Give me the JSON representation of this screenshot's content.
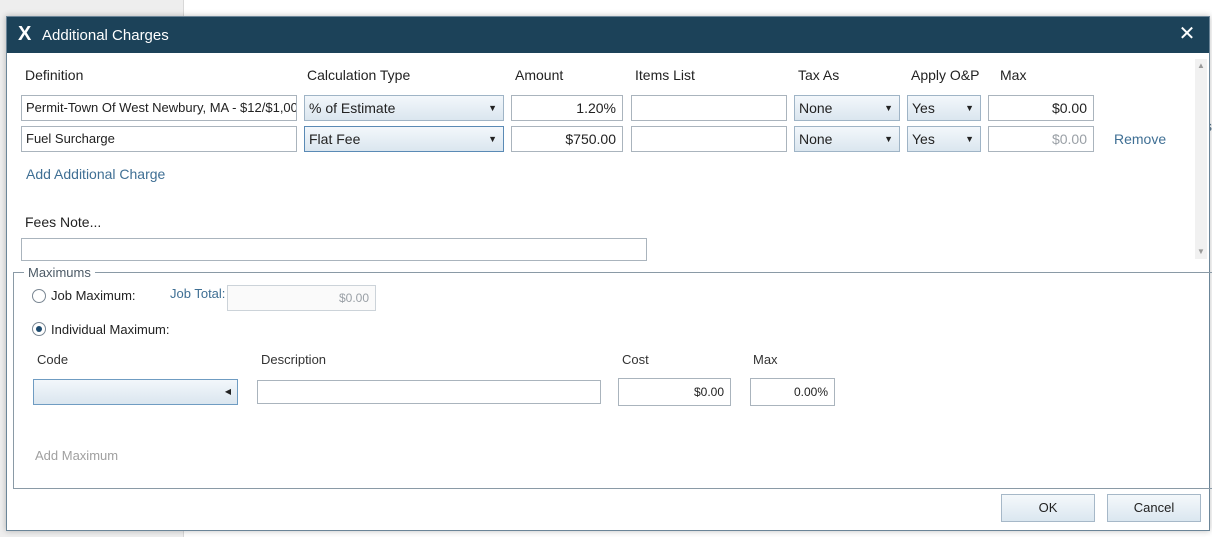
{
  "background": {
    "edge_glyph_1": "s",
    "edge_glyph_2": "r"
  },
  "dialog": {
    "title": "Additional Charges",
    "icons": {
      "app": "app-x-logo-icon",
      "close": "close-icon"
    }
  },
  "charges": {
    "headers": {
      "definition": "Definition",
      "calculation_type": "Calculation Type",
      "amount": "Amount",
      "items_list": "Items List",
      "tax_as": "Tax As",
      "apply_op": "Apply O&P",
      "max": "Max"
    },
    "rows": [
      {
        "definition": "Permit-Town Of West Newbury, MA - $12/$1,00",
        "calculation_type": "% of Estimate",
        "amount": "1.20%",
        "items_list": "",
        "tax_as": "None",
        "apply_op": "Yes",
        "max": "$0.00",
        "remove_label": ""
      },
      {
        "definition": "Fuel Surcharge",
        "calculation_type": "Flat Fee",
        "amount": "$750.00",
        "items_list": "",
        "tax_as": "None",
        "apply_op": "Yes",
        "max": "$0.00",
        "remove_label": "Remove"
      }
    ],
    "add_label": "Add Additional Charge",
    "fees_note_label": "Fees Note...",
    "fees_note_value": ""
  },
  "maximums": {
    "legend": "Maximums",
    "job_maximum_label": "Job Maximum:",
    "job_total_label": "Job Total:",
    "job_total_value": "$0.00",
    "individual_maximum_label": "Individual Maximum:",
    "selected": "individual",
    "headers": {
      "code": "Code",
      "description": "Description",
      "cost": "Cost",
      "max": "Max"
    },
    "row": {
      "code": "",
      "description": "",
      "cost": "$0.00",
      "max": "0.00%"
    },
    "add_label": "Add Maximum"
  },
  "footer": {
    "ok_label": "OK",
    "cancel_label": "Cancel"
  }
}
